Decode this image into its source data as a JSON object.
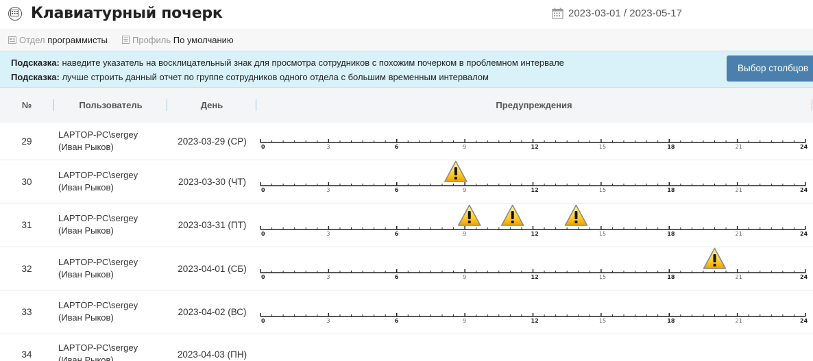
{
  "header": {
    "title": "Клавиатурный почерк",
    "title_icon": "keyboard-icon",
    "date_range": "2023-03-01 / 2023-05-17",
    "calendar_icon": "calendar-icon"
  },
  "filters": {
    "department_label": "Отдел",
    "department_value": "программисты",
    "profile_label": "Профиль",
    "profile_value": "По умолчанию"
  },
  "hints": {
    "prefix": "Подсказка:",
    "hint1": " наведите указатель на восклицательный знак для просмотра сотрудников с похожим почерком в проблемном интервале",
    "hint2": " лучше строить данный отчет по группе сотрудников одного отдела с большим временным интервалом",
    "columns_button": "Выбор столбцов"
  },
  "table": {
    "headers": {
      "num": "№",
      "user": "Пользователь",
      "day": "День",
      "warnings": "Предупреждения"
    },
    "axis_ticks": [
      "0",
      "3",
      "6",
      "9",
      "12",
      "15",
      "18",
      "21",
      "24"
    ],
    "rows": [
      {
        "num": "29",
        "user_line1": "LAPTOP-PC\\sergey",
        "user_line2": "(Иван Рыков)",
        "day": "2023-03-29 (СР)",
        "warning_hours": []
      },
      {
        "num": "30",
        "user_line1": "LAPTOP-PC\\sergey",
        "user_line2": "(Иван Рыков)",
        "day": "2023-03-30 (ЧТ)",
        "warning_hours": [
          8.6
        ]
      },
      {
        "num": "31",
        "user_line1": "LAPTOP-PC\\sergey",
        "user_line2": "(Иван Рыков)",
        "day": "2023-03-31 (ПТ)",
        "warning_hours": [
          9.2,
          11.1,
          13.9
        ]
      },
      {
        "num": "32",
        "user_line1": "LAPTOP-PC\\sergey",
        "user_line2": "(Иван Рыков)",
        "day": "2023-04-01 (СБ)",
        "warning_hours": [
          20.0
        ]
      },
      {
        "num": "33",
        "user_line1": "LAPTOP-PC\\sergey",
        "user_line2": "(Иван Рыков)",
        "day": "2023-04-02 (ВС)",
        "warning_hours": []
      },
      {
        "num": "34",
        "user_line1": "LAPTOP-PC\\sergey",
        "user_line2": "(Иван Рыков)",
        "day": "2023-04-03 (ПН)",
        "warning_hours": []
      }
    ]
  }
}
